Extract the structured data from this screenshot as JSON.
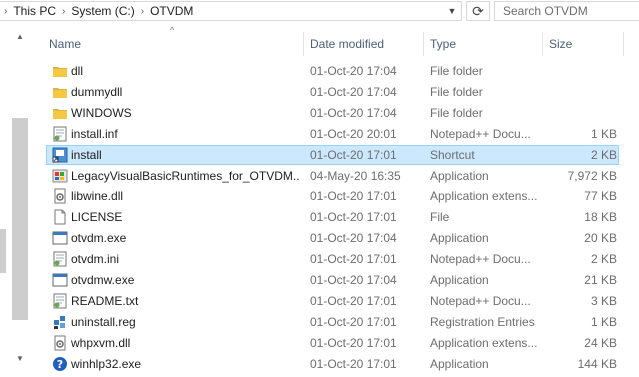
{
  "address": {
    "crumbs": [
      "This PC",
      "System (C:)",
      "OTVDM"
    ],
    "dropdown_icon": "chevron-down-icon"
  },
  "refresh_icon": "refresh-icon",
  "search": {
    "placeholder": "Search OTVDM"
  },
  "columns": {
    "name": "Name",
    "date": "Date modified",
    "type": "Type",
    "size": "Size"
  },
  "colors": {
    "selection_bg": "#cce8ff",
    "selection_border": "#99d1ff",
    "header_text": "#4c607a",
    "folder": "#f5c842"
  },
  "files": [
    {
      "name": "dll",
      "date": "01-Oct-20 17:04",
      "type": "File folder",
      "size": "",
      "icon": "folder-icon"
    },
    {
      "name": "dummydll",
      "date": "01-Oct-20 17:04",
      "type": "File folder",
      "size": "",
      "icon": "folder-icon"
    },
    {
      "name": "WINDOWS",
      "date": "01-Oct-20 17:04",
      "type": "File folder",
      "size": "",
      "icon": "folder-icon"
    },
    {
      "name": "install.inf",
      "date": "01-Oct-20 20:01",
      "type": "Notepad++ Docu...",
      "size": "1 KB",
      "icon": "notepadpp-icon"
    },
    {
      "name": "install",
      "date": "01-Oct-20 17:01",
      "type": "Shortcut",
      "size": "2 KB",
      "icon": "shortcut-icon",
      "selected": true
    },
    {
      "name": "LegacyVisualBasicRuntimes_for_OTVDM....",
      "date": "04-May-20 16:35",
      "type": "Application",
      "size": "7,972 KB",
      "icon": "installer-icon"
    },
    {
      "name": "libwine.dll",
      "date": "01-Oct-20 17:01",
      "type": "Application extens...",
      "size": "77 KB",
      "icon": "dll-icon"
    },
    {
      "name": "LICENSE",
      "date": "01-Oct-20 17:01",
      "type": "File",
      "size": "18 KB",
      "icon": "file-icon"
    },
    {
      "name": "otvdm.exe",
      "date": "01-Oct-20 17:04",
      "type": "Application",
      "size": "20 KB",
      "icon": "exe-icon"
    },
    {
      "name": "otvdm.ini",
      "date": "01-Oct-20 17:01",
      "type": "Notepad++ Docu...",
      "size": "2 KB",
      "icon": "notepadpp-icon"
    },
    {
      "name": "otvdmw.exe",
      "date": "01-Oct-20 17:04",
      "type": "Application",
      "size": "21 KB",
      "icon": "exe-icon"
    },
    {
      "name": "README.txt",
      "date": "01-Oct-20 17:01",
      "type": "Notepad++ Docu...",
      "size": "3 KB",
      "icon": "notepadpp-icon"
    },
    {
      "name": "uninstall.reg",
      "date": "01-Oct-20 17:01",
      "type": "Registration Entries",
      "size": "1 KB",
      "icon": "registry-icon"
    },
    {
      "name": "whpxvm.dll",
      "date": "01-Oct-20 17:01",
      "type": "Application extens...",
      "size": "24 KB",
      "icon": "dll-icon"
    },
    {
      "name": "winhlp32.exe",
      "date": "01-Oct-20 17:01",
      "type": "Application",
      "size": "144 KB",
      "icon": "help-icon"
    }
  ]
}
